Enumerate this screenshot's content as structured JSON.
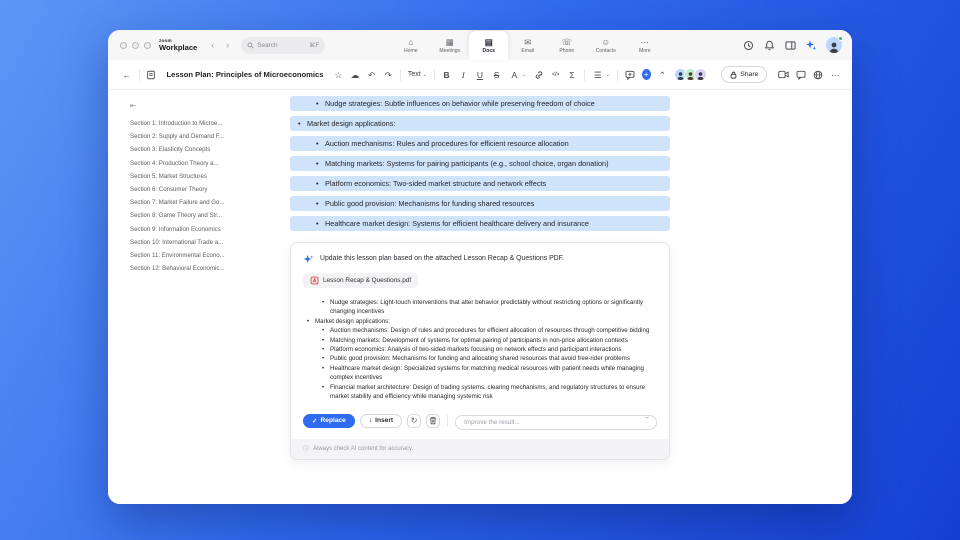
{
  "colors": {
    "accent_blue": "#2f6cf0",
    "highlight_blue": "#cfe3fa",
    "pdf_red": "#e14b41"
  },
  "titlebar": {
    "brand_top": "zoom",
    "brand": "Workplace",
    "search_placeholder": "Search",
    "search_shortcut": "⌘F",
    "chev_left": "‹",
    "chev_right": "›",
    "tabs": [
      {
        "label": "Home",
        "glyph": "⌂"
      },
      {
        "label": "Meetings",
        "glyph": "▦"
      },
      {
        "label": "Docs",
        "glyph": "▤",
        "active": true
      },
      {
        "label": "Email",
        "glyph": "✉"
      },
      {
        "label": "Phone",
        "glyph": "☏"
      },
      {
        "label": "Contacts",
        "glyph": "☺"
      },
      {
        "label": "More",
        "glyph": "⋯"
      }
    ]
  },
  "doc_toolbar": {
    "title": "Lesson Plan: Principles of Microeconomics",
    "text_style_label": "Text",
    "share_label": "Share"
  },
  "glyphs": {
    "back": "←",
    "star": "☆",
    "cloud": "☁",
    "undo": "↶",
    "redo": "↷",
    "caret_down": "⌄",
    "bold": "B",
    "italic": "I",
    "underline": "U",
    "strike": "S",
    "text_color": "A",
    "code": "</>",
    "sigma": "Σ",
    "list": "☰",
    "collapse_up": "⌃",
    "more_h": "⋯",
    "plus": "+",
    "check": "✓",
    "insert_arrow": "↓",
    "refresh": "↻",
    "send": "→",
    "sidebar_collapse": "⇤",
    "info": "ⓘ"
  },
  "sidebar": {
    "items": [
      "Section 1: Introduction to Microe...",
      "Section 2: Supply and Demand F...",
      "Section 3: Elasticity Concepts",
      "Section 4: Production Theory a...",
      "Section 5: Market Structures",
      "Section 6: Consumer Theory",
      "Section 7: Market Failure and Go...",
      "Section 8: Game Theory and Str...",
      "Section 9: Information Economics",
      "Section 10: International Trade a...",
      "Section 11: Environmental Econo...",
      "Section 12: Behavioral Economic..."
    ]
  },
  "document": {
    "highlighted_lines": [
      {
        "indent": 2,
        "text": "Nudge strategies: Subtle influences on behavior while preserving freedom of choice"
      },
      {
        "indent": 1,
        "text": "Market design applications:"
      },
      {
        "indent": 2,
        "text": "Auction mechanisms: Rules and procedures for efficient resource allocation"
      },
      {
        "indent": 2,
        "text": "Matching markets: Systems for pairing participants (e.g., school choice, organ donation)"
      },
      {
        "indent": 2,
        "text": "Platform economics: Two-sided market structure and network effects"
      },
      {
        "indent": 2,
        "text": "Public good provision: Mechanisms for funding shared resources"
      },
      {
        "indent": 2,
        "text": "Healthcare market design: Systems for efficient healthcare delivery and insurance"
      }
    ]
  },
  "ai_panel": {
    "prompt": "Update this lesson plan based on the attached Lesson Recap & Questions PDF.",
    "attachment_name": "Lesson Recap & Questions.pdf",
    "result_bullets": [
      {
        "indent": 2,
        "text": "Nudge strategies: Light-touch interventions that alter behavior predictably without restricting options or significantly changing incentives"
      },
      {
        "indent": 1,
        "text": "Market design applications:"
      },
      {
        "indent": 2,
        "text": "Auction mechanisms: Design of rules and procedures for efficient allocation of resources through competitive bidding"
      },
      {
        "indent": 2,
        "text": "Matching markets: Development of systems for optimal pairing of participants in non-price allocation contexts"
      },
      {
        "indent": 2,
        "text": "Platform economics: Analysis of two-sided markets focusing on network effects and participant interactions"
      },
      {
        "indent": 2,
        "text": "Public good provision: Mechanisms for funding and allocating shared resources that avoid free-rider problems"
      },
      {
        "indent": 2,
        "text": "Healthcare market design: Specialized systems for matching medical resources with patient needs while managing complex incentives"
      },
      {
        "indent": 2,
        "text": "Financial market architecture: Design of trading systems, clearing mechanisms, and regulatory structures to ensure market stability and efficiency while managing systemic risk"
      }
    ],
    "replace_label": "Replace",
    "insert_label": "Insert",
    "improve_placeholder": "Improve the result...",
    "footer_note": "Always check AI content for accuracy."
  }
}
